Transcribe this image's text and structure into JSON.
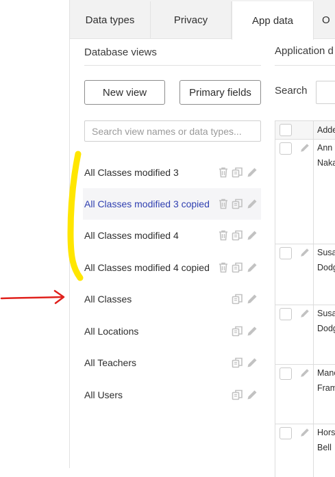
{
  "tabs": [
    {
      "label": "Data types"
    },
    {
      "label": "Privacy"
    },
    {
      "label": "App data",
      "active": true
    },
    {
      "label": "O"
    }
  ],
  "views_panel": {
    "title": "Database views",
    "new_view_label": "New view",
    "primary_fields_label": "Primary fields",
    "search_placeholder": "Search view names or data types...",
    "items": [
      {
        "label": "All Classes modified 3",
        "deletable": true,
        "highlighted": false
      },
      {
        "label": "All Classes modified 3 copied",
        "deletable": true,
        "highlighted": true
      },
      {
        "label": "All Classes modified 4",
        "deletable": true,
        "highlighted": false
      },
      {
        "label": "All Classes modified 4 copied",
        "deletable": true,
        "highlighted": false
      },
      {
        "label": "All Classes",
        "deletable": false,
        "highlighted": false
      },
      {
        "label": "All Locations",
        "deletable": false,
        "highlighted": false
      },
      {
        "label": "All Teachers",
        "deletable": false,
        "highlighted": false
      },
      {
        "label": "All Users",
        "deletable": false,
        "highlighted": false
      }
    ]
  },
  "data_panel": {
    "title": "Application d",
    "search_label": "Search",
    "table": {
      "column_header": "Adde",
      "rows": [
        {
          "line1": "Ann",
          "line2": "Naka"
        },
        {
          "line1": "Susa",
          "line2": "Dodg"
        },
        {
          "line1": "Susa",
          "line2": "Dodg"
        },
        {
          "line1": "Manc",
          "line2": "Fram"
        },
        {
          "line1": "Hors",
          "line2": "Bell"
        }
      ]
    }
  },
  "colors": {
    "highlight_text": "#2f3fb0",
    "highlight_bg": "#f5f5f7",
    "annotation_yellow": "#ffe600",
    "annotation_red": "#e0201b"
  }
}
